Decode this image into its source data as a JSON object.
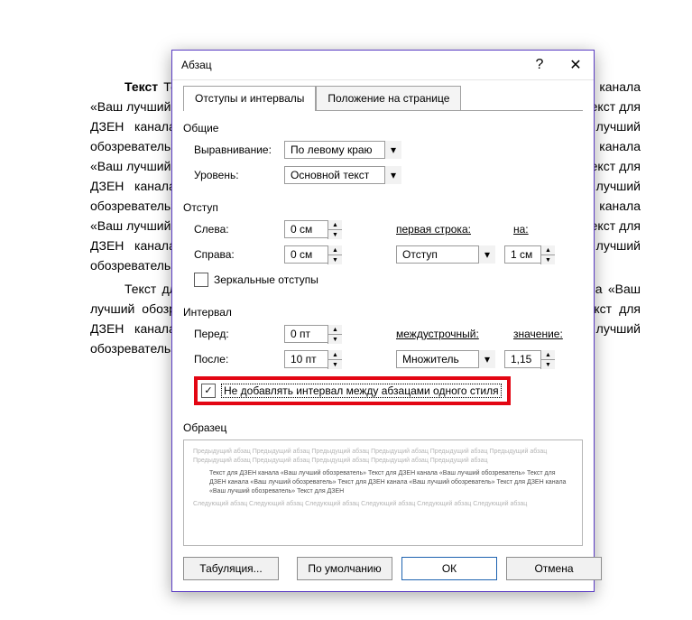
{
  "background_text": "Текст для ДЗЕН канала «Ваш лучший обозреватель» Текст для ДЗЕН канала «Ваш лучший обозреватель» Текст для ДЗЕН канала «Ваш лучший обозреватель» Текст для ДЗЕН канала «Ваш лучший обозреватель» Текст для ДЗЕН канала «Ваш лучший обозреватель» Текст для ДЗЕН канала «Ваш лучший обозреватель» Текст для ДЗЕН канала «Ваш лучший обозреватель» Текст для ДЗЕН канала «Ваш лучший обозреватель» Текст для ДЗЕН канала «Ваш лучший обозреватель» Текст для ДЗЕН канала «Ваш лучший обозреватель» Текст для ДЗЕН канала «Ваш лучший обозреватель» Текст для ДЗЕН канала «Ваш лучший обозреватель» Текст для ДЗЕН канала «Ваш лучший обозреватель» Текст для ДЗЕН канала «Ваш лучший обозреватель» Текст для ДЗЕН канала «Ваш лучший обозреватель» Текст для ДЗЕН канала",
  "background_text2": "Текст для ДЗЕН канала «Ваш лучший обозреватель» Текст для ДЗЕН канала «Ваш лучший обозреватель» Текст для ДЗЕН канала «Ваш лучший обозреватель» Текст для ДЗЕН канала «Ваш лучший обозреватель» Текст для ДЗЕН канала «Ваш лучший обозреватель» Текст для ДЗЕН канала «Ваш лучший обозреватель»",
  "dialog": {
    "title": "Абзац",
    "help": "?",
    "close": "✕",
    "tabs": {
      "t1": "Отступы и интервалы",
      "t2": "Положение на странице"
    },
    "groups": {
      "general": "Общие",
      "indent": "Отступ",
      "interval": "Интервал",
      "preview": "Образец"
    },
    "general": {
      "align_label": "Выравнивание:",
      "align_value": "По левому краю",
      "level_label": "Уровень:",
      "level_value": "Основной текст"
    },
    "indent": {
      "left_label": "Слева:",
      "left_value": "0 см",
      "right_label": "Справа:",
      "right_value": "0 см",
      "firstline_label": "первая строка:",
      "firstline_value": "Отступ",
      "by_label": "на:",
      "by_value": "1 см",
      "mirror_checkbox": "Зеркальные отступы"
    },
    "interval": {
      "before_label": "Перед:",
      "before_value": "0 пт",
      "after_label": "После:",
      "after_value": "10 пт",
      "linespacing_label": "междустрочный:",
      "linespacing_value": "Множитель",
      "at_label": "значение:",
      "at_value": "1,15",
      "nospace_checkbox": "Не добавлять интервал между абзацами одного стиля"
    },
    "preview": {
      "prev": "Предыдущий абзац Предыдущий абзац Предыдущий абзац Предыдущий абзац Предыдущий абзац Предыдущий абзац Предыдущий абзац Предыдущий абзац Предыдущий абзац Предыдущий абзац Предыдущий абзац",
      "main": "Текст для ДЗЕН канала «Ваш лучший обозреватель» Текст для ДЗЕН канала «Ваш лучший обозреватель» Текст для ДЗЕН канала «Ваш лучший обозреватель» Текст для ДЗЕН канала «Ваш лучший обозреватель» Текст для ДЗЕН канала «Ваш лучший обозреватель» Текст для ДЗЕН",
      "next": "Следующий абзац Следующий абзац Следующий абзац Следующий абзац Следующий абзац Следующий абзац"
    },
    "buttons": {
      "tabs": "Табуляция...",
      "default": "По умолчанию",
      "ok": "ОК",
      "cancel": "Отмена"
    }
  }
}
